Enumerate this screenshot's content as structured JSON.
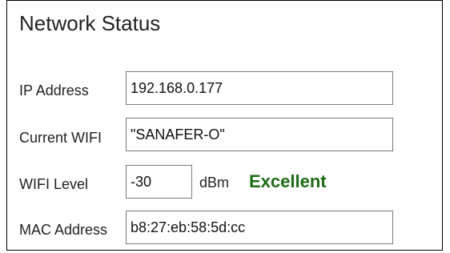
{
  "panel": {
    "title": "Network Status"
  },
  "fields": {
    "ip_address": {
      "label": "IP Address",
      "value": "192.168.0.177"
    },
    "current_wifi": {
      "label": "Current WIFI",
      "value": "\"SANAFER-O\""
    },
    "wifi_level": {
      "label": "WIFI Level",
      "value": "-30",
      "unit": "dBm",
      "quality": "Excellent",
      "quality_color": "#1e6b16"
    },
    "mac_address": {
      "label": "MAC Address",
      "value": "b8:27:eb:58:5d:cc"
    }
  }
}
